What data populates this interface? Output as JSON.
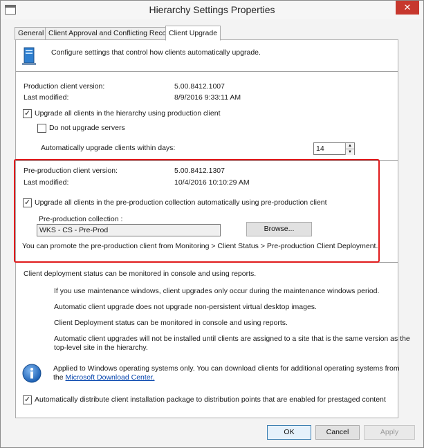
{
  "window": {
    "title": "Hierarchy Settings Properties",
    "close_glyph": "✕"
  },
  "tabs": [
    {
      "label": "General"
    },
    {
      "label": "Client Approval and Conflicting Records"
    },
    {
      "label": "Client Upgrade"
    }
  ],
  "header": {
    "description": "Configure settings that control how clients automatically upgrade."
  },
  "production": {
    "version_label": "Production client version:",
    "version_value": "5.00.8412.1007",
    "modified_label": "Last modified:",
    "modified_value": "8/9/2016 9:33:11 AM",
    "upgrade_all_label": "Upgrade all clients in the hierarchy using production client",
    "upgrade_all_checked": true,
    "no_servers_label": "Do not upgrade servers",
    "no_servers_checked": false,
    "days_label": "Automatically upgrade clients within days:",
    "days_value": "14"
  },
  "preproduction": {
    "version_label": "Pre-production client version:",
    "version_value": "5.00.8412.1307",
    "modified_label": "Last modified:",
    "modified_value": "10/4/2016 10:10:29 AM",
    "upgrade_label": "Upgrade all clients in the pre-production collection automatically using pre-production client",
    "upgrade_checked": true,
    "collection_label": "Pre-production collection :",
    "collection_value": "WKS - CS - Pre-Prod",
    "browse_label": "Browse...",
    "promote_note": "You can promote the pre-production client from Monitoring > Client Status > Pre-production Client Deployment."
  },
  "notes": {
    "status_line": "Client deployment status can be monitored in console and using reports.",
    "items": [
      "If you use maintenance windows, client upgrades only occur during the maintenance windows period.",
      "Automatic client upgrade does not upgrade non-persistent virtual desktop images.",
      "Client Deployment status can be monitored in console and using reports.",
      "Automatic client upgrades will not be installed until clients are assigned to a site that is the same version as the",
      "top-level site in the hierarchy."
    ],
    "info_line1": "Applied to Windows operating systems only. You can download clients for additional operating systems from",
    "info_line2_prefix": "the ",
    "info_link": "Microsoft Download Center.",
    "distribute_label": "Automatically distribute client installation package to distribution points that are enabled for prestaged content",
    "distribute_checked": true
  },
  "footer": {
    "ok_label": "OK",
    "cancel_label": "Cancel",
    "apply_label": "Apply"
  },
  "colors": {
    "highlight_border": "#e0191b",
    "close_button": "#c7382e",
    "link": "#0645ad"
  }
}
